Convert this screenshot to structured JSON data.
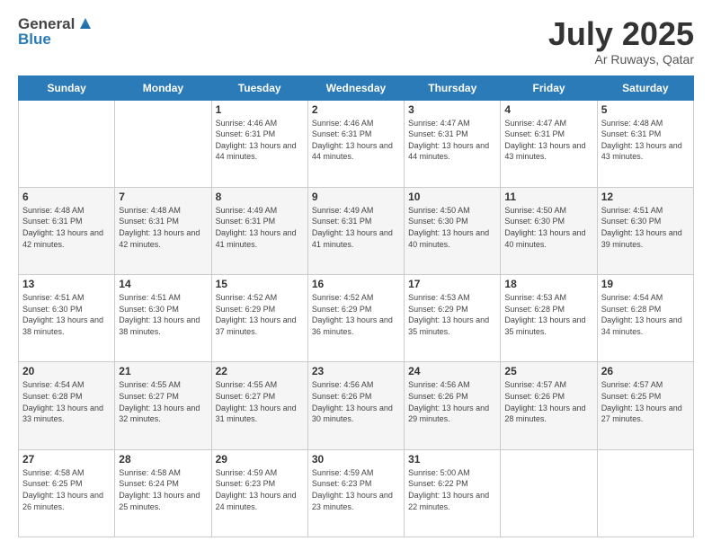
{
  "logo": {
    "general": "General",
    "blue": "Blue"
  },
  "header": {
    "month": "July 2025",
    "location": "Ar Ruways, Qatar"
  },
  "days": [
    "Sunday",
    "Monday",
    "Tuesday",
    "Wednesday",
    "Thursday",
    "Friday",
    "Saturday"
  ],
  "weeks": [
    [
      {
        "day": null,
        "content": null
      },
      {
        "day": null,
        "content": null
      },
      {
        "day": "1",
        "content": "Sunrise: 4:46 AM\nSunset: 6:31 PM\nDaylight: 13 hours and 44 minutes."
      },
      {
        "day": "2",
        "content": "Sunrise: 4:46 AM\nSunset: 6:31 PM\nDaylight: 13 hours and 44 minutes."
      },
      {
        "day": "3",
        "content": "Sunrise: 4:47 AM\nSunset: 6:31 PM\nDaylight: 13 hours and 44 minutes."
      },
      {
        "day": "4",
        "content": "Sunrise: 4:47 AM\nSunset: 6:31 PM\nDaylight: 13 hours and 43 minutes."
      },
      {
        "day": "5",
        "content": "Sunrise: 4:48 AM\nSunset: 6:31 PM\nDaylight: 13 hours and 43 minutes."
      }
    ],
    [
      {
        "day": "6",
        "content": "Sunrise: 4:48 AM\nSunset: 6:31 PM\nDaylight: 13 hours and 42 minutes."
      },
      {
        "day": "7",
        "content": "Sunrise: 4:48 AM\nSunset: 6:31 PM\nDaylight: 13 hours and 42 minutes."
      },
      {
        "day": "8",
        "content": "Sunrise: 4:49 AM\nSunset: 6:31 PM\nDaylight: 13 hours and 41 minutes."
      },
      {
        "day": "9",
        "content": "Sunrise: 4:49 AM\nSunset: 6:31 PM\nDaylight: 13 hours and 41 minutes."
      },
      {
        "day": "10",
        "content": "Sunrise: 4:50 AM\nSunset: 6:30 PM\nDaylight: 13 hours and 40 minutes."
      },
      {
        "day": "11",
        "content": "Sunrise: 4:50 AM\nSunset: 6:30 PM\nDaylight: 13 hours and 40 minutes."
      },
      {
        "day": "12",
        "content": "Sunrise: 4:51 AM\nSunset: 6:30 PM\nDaylight: 13 hours and 39 minutes."
      }
    ],
    [
      {
        "day": "13",
        "content": "Sunrise: 4:51 AM\nSunset: 6:30 PM\nDaylight: 13 hours and 38 minutes."
      },
      {
        "day": "14",
        "content": "Sunrise: 4:51 AM\nSunset: 6:30 PM\nDaylight: 13 hours and 38 minutes."
      },
      {
        "day": "15",
        "content": "Sunrise: 4:52 AM\nSunset: 6:29 PM\nDaylight: 13 hours and 37 minutes."
      },
      {
        "day": "16",
        "content": "Sunrise: 4:52 AM\nSunset: 6:29 PM\nDaylight: 13 hours and 36 minutes."
      },
      {
        "day": "17",
        "content": "Sunrise: 4:53 AM\nSunset: 6:29 PM\nDaylight: 13 hours and 35 minutes."
      },
      {
        "day": "18",
        "content": "Sunrise: 4:53 AM\nSunset: 6:28 PM\nDaylight: 13 hours and 35 minutes."
      },
      {
        "day": "19",
        "content": "Sunrise: 4:54 AM\nSunset: 6:28 PM\nDaylight: 13 hours and 34 minutes."
      }
    ],
    [
      {
        "day": "20",
        "content": "Sunrise: 4:54 AM\nSunset: 6:28 PM\nDaylight: 13 hours and 33 minutes."
      },
      {
        "day": "21",
        "content": "Sunrise: 4:55 AM\nSunset: 6:27 PM\nDaylight: 13 hours and 32 minutes."
      },
      {
        "day": "22",
        "content": "Sunrise: 4:55 AM\nSunset: 6:27 PM\nDaylight: 13 hours and 31 minutes."
      },
      {
        "day": "23",
        "content": "Sunrise: 4:56 AM\nSunset: 6:26 PM\nDaylight: 13 hours and 30 minutes."
      },
      {
        "day": "24",
        "content": "Sunrise: 4:56 AM\nSunset: 6:26 PM\nDaylight: 13 hours and 29 minutes."
      },
      {
        "day": "25",
        "content": "Sunrise: 4:57 AM\nSunset: 6:26 PM\nDaylight: 13 hours and 28 minutes."
      },
      {
        "day": "26",
        "content": "Sunrise: 4:57 AM\nSunset: 6:25 PM\nDaylight: 13 hours and 27 minutes."
      }
    ],
    [
      {
        "day": "27",
        "content": "Sunrise: 4:58 AM\nSunset: 6:25 PM\nDaylight: 13 hours and 26 minutes."
      },
      {
        "day": "28",
        "content": "Sunrise: 4:58 AM\nSunset: 6:24 PM\nDaylight: 13 hours and 25 minutes."
      },
      {
        "day": "29",
        "content": "Sunrise: 4:59 AM\nSunset: 6:23 PM\nDaylight: 13 hours and 24 minutes."
      },
      {
        "day": "30",
        "content": "Sunrise: 4:59 AM\nSunset: 6:23 PM\nDaylight: 13 hours and 23 minutes."
      },
      {
        "day": "31",
        "content": "Sunrise: 5:00 AM\nSunset: 6:22 PM\nDaylight: 13 hours and 22 minutes."
      },
      {
        "day": null,
        "content": null
      },
      {
        "day": null,
        "content": null
      }
    ]
  ]
}
